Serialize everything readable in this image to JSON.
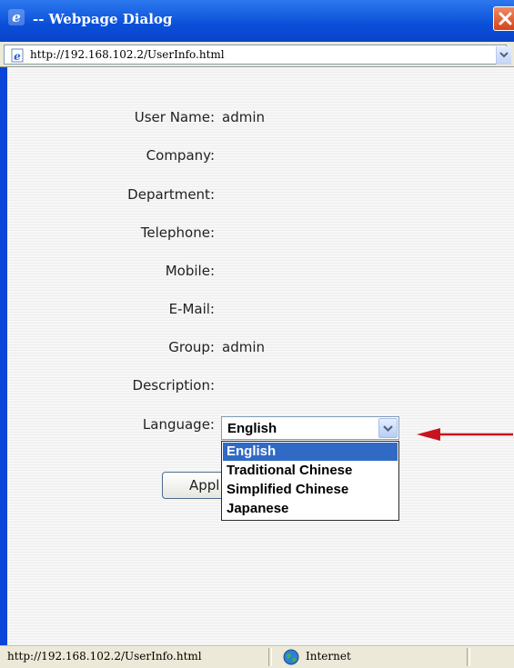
{
  "titlebar": {
    "title": "-- Webpage Dialog"
  },
  "addressbar": {
    "url": "http://192.168.102.2/UserInfo.html"
  },
  "form": {
    "fields": [
      {
        "label": "User Name:",
        "value": "admin"
      },
      {
        "label": "Company:",
        "value": ""
      },
      {
        "label": "Department:",
        "value": ""
      },
      {
        "label": "Telephone:",
        "value": ""
      },
      {
        "label": "Mobile:",
        "value": ""
      },
      {
        "label": "E-Mail:",
        "value": ""
      },
      {
        "label": "Group:",
        "value": "admin"
      },
      {
        "label": "Description:",
        "value": ""
      }
    ],
    "language": {
      "label": "Language:",
      "selected": "English",
      "options": [
        "English",
        "Traditional Chinese",
        "Simplified Chinese",
        "Japanese"
      ]
    },
    "apply_label": "Appl"
  },
  "statusbar": {
    "url": "http://192.168.102.2/UserInfo.html",
    "zone": "Internet"
  },
  "colors": {
    "titlebar": "#0a4fd9",
    "selection": "#316ac5",
    "arrow": "#c8141e",
    "close": "#d64217"
  },
  "icons": {
    "title": "ie-icon",
    "close": "close-icon",
    "address": "page-icon",
    "dropdown": "chevron-down-icon",
    "zone": "globe-icon",
    "annotation": "arrow-left-icon"
  }
}
